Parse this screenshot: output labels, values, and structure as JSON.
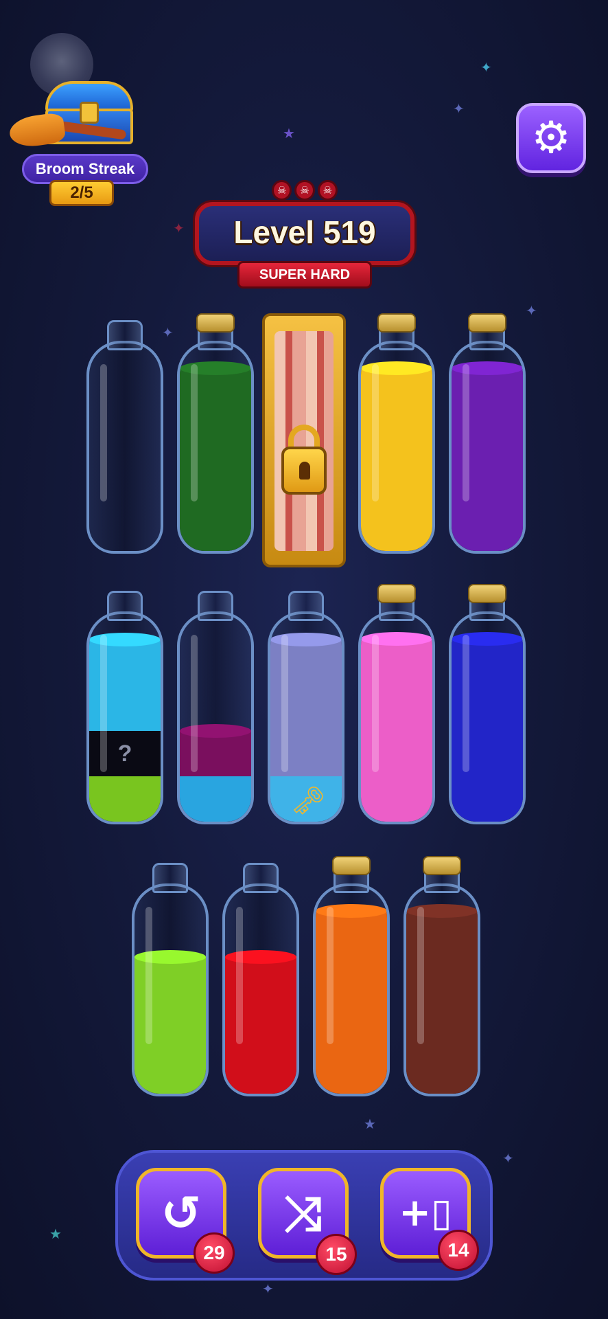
{
  "streak": {
    "label": "Broom Streak",
    "count": "2/5"
  },
  "level": {
    "title": "Level 519",
    "difficulty": "SUPER HARD",
    "skull_count": 3
  },
  "tubes": [
    {
      "row": 1,
      "col": 1,
      "corked": false,
      "segments": []
    },
    {
      "row": 1,
      "col": 2,
      "corked": true,
      "segments": [
        {
          "color": "#1f6a22",
          "fill": 0.88
        }
      ]
    },
    {
      "row": 1,
      "col": 3,
      "locked": true
    },
    {
      "row": 1,
      "col": 4,
      "corked": true,
      "segments": [
        {
          "color": "#f4c21d",
          "fill": 0.88
        }
      ]
    },
    {
      "row": 1,
      "col": 5,
      "corked": true,
      "segments": [
        {
          "color": "#6b1fb0",
          "fill": 0.88
        }
      ]
    },
    {
      "row": 2,
      "col": 1,
      "corked": false,
      "segments": [
        {
          "color": "#79c51f",
          "fill": 0.22
        },
        {
          "color": "#0a0a14",
          "fill": 0.22,
          "mystery": "?"
        },
        {
          "color": "#2bb6e6",
          "fill": 0.44
        }
      ]
    },
    {
      "row": 2,
      "col": 2,
      "corked": false,
      "segments": [
        {
          "color": "#29a5e0",
          "fill": 0.22
        },
        {
          "color": "#7a0f5e",
          "fill": 0.22
        }
      ]
    },
    {
      "row": 2,
      "col": 3,
      "corked": false,
      "segments": [
        {
          "color": "#3fb3e8",
          "fill": 0.22,
          "key": true
        },
        {
          "color": "#7c80c4",
          "fill": 0.66
        }
      ]
    },
    {
      "row": 2,
      "col": 4,
      "corked": true,
      "segments": [
        {
          "color": "#ec5ec8",
          "fill": 0.88
        }
      ]
    },
    {
      "row": 2,
      "col": 5,
      "corked": true,
      "segments": [
        {
          "color": "#2225c8",
          "fill": 0.88
        }
      ]
    },
    {
      "row": 3,
      "col": 1,
      "corked": false,
      "segments": [
        {
          "color": "#7fcf26",
          "fill": 0.66
        }
      ]
    },
    {
      "row": 3,
      "col": 2,
      "corked": false,
      "segments": [
        {
          "color": "#d10e1a",
          "fill": 0.66
        }
      ]
    },
    {
      "row": 3,
      "col": 3,
      "corked": true,
      "segments": [
        {
          "color": "#ea6612",
          "fill": 0.88
        }
      ]
    },
    {
      "row": 3,
      "col": 4,
      "corked": true,
      "segments": [
        {
          "color": "#6b2a20",
          "fill": 0.88
        }
      ]
    }
  ],
  "powerups": [
    {
      "name": "undo",
      "glyph": "↺",
      "count": "29"
    },
    {
      "name": "shuffle",
      "glyph": "⤨",
      "count": "15"
    },
    {
      "name": "add-bottle",
      "glyph": "+▯",
      "count": "14"
    }
  ]
}
